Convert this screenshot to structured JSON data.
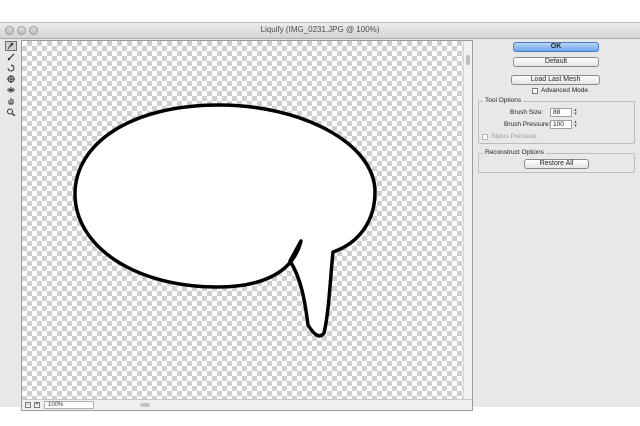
{
  "window": {
    "title": "Liquify (IMG_0231.JPG @ 100%)"
  },
  "toolbar": {
    "tools": [
      "forward-warp-tool",
      "reconstruct-tool",
      "twirl-tool",
      "pucker-tool",
      "bloat-tool",
      "hand-tool",
      "zoom-tool"
    ]
  },
  "status": {
    "zoom": "100%"
  },
  "panel": {
    "ok_label": "OK",
    "default_label": "Default",
    "load_last_mesh_label": "Load Last Mesh",
    "advanced_mode_label": "Advanced Mode",
    "tool_options": {
      "legend": "Tool Options",
      "brush_size_label": "Brush Size:",
      "brush_size_value": "88",
      "brush_pressure_label": "Brush Pressure:",
      "brush_pressure_value": "100",
      "stylus_pressure_label": "Stylus Pressure"
    },
    "reconstruct_options": {
      "legend": "Reconstruct Options",
      "restore_all_label": "Restore All"
    }
  },
  "colors": {
    "accent": "#6fa6ea",
    "checker": "#cfcfcf"
  }
}
